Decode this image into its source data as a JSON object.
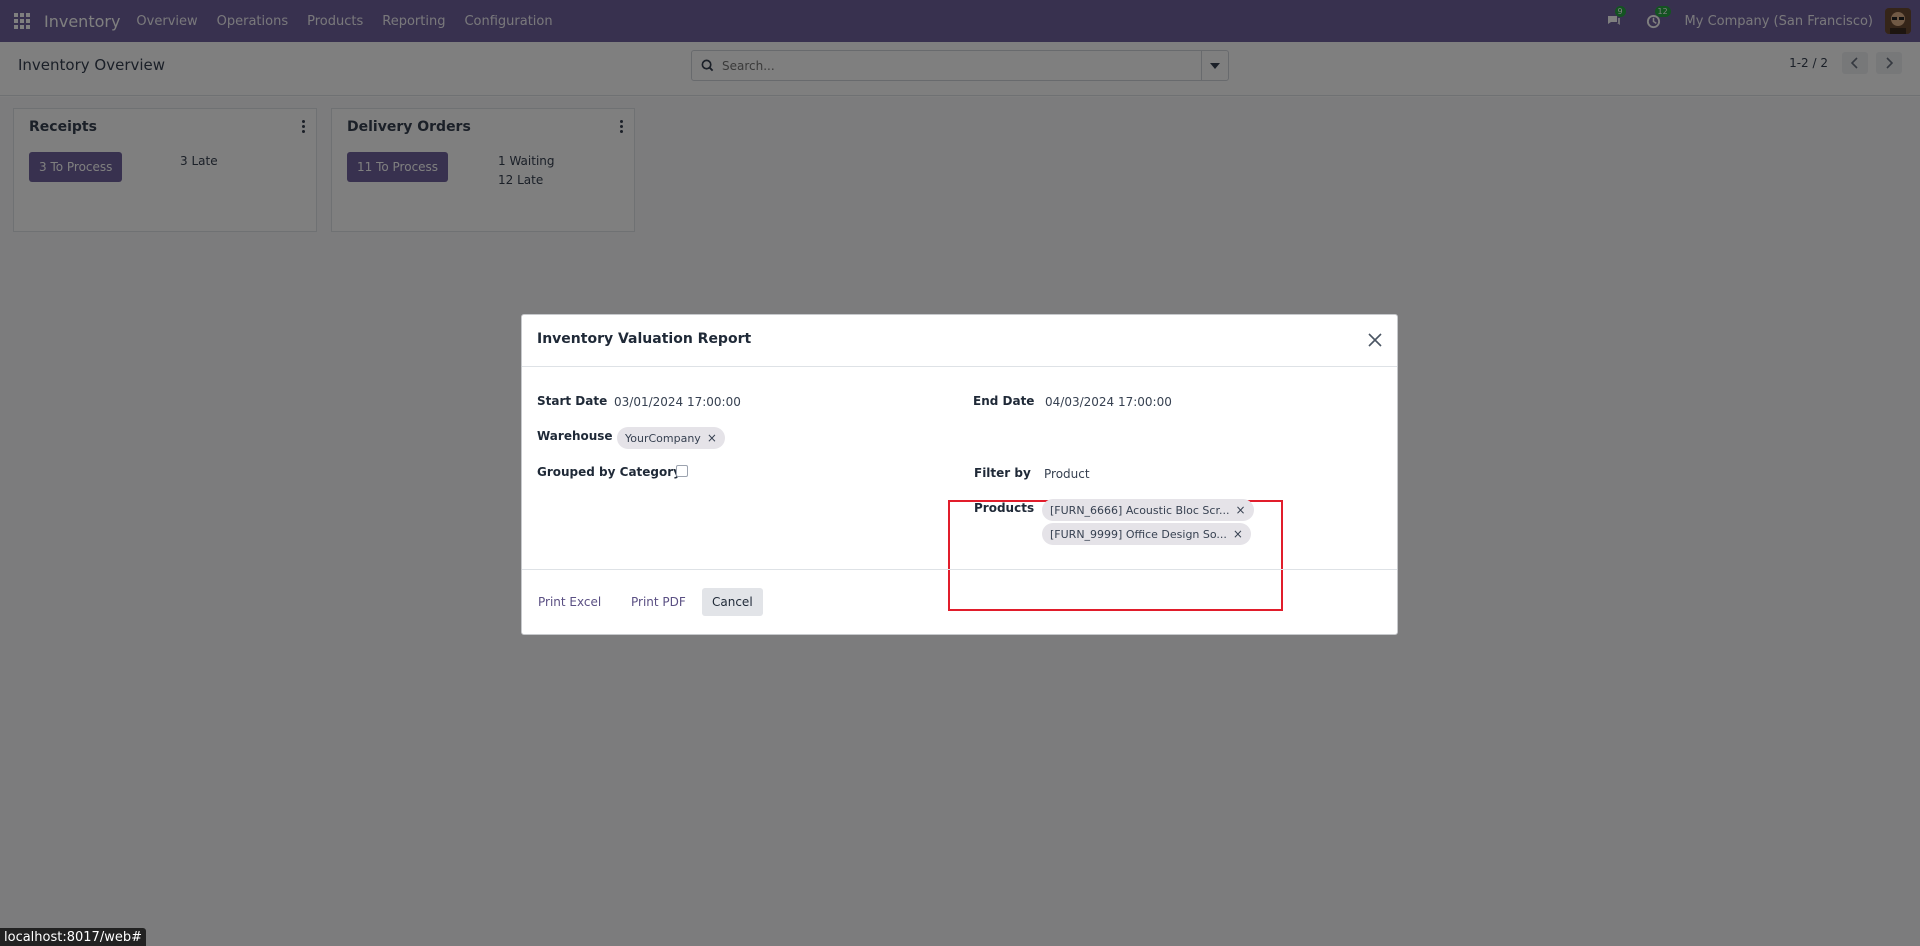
{
  "navbar": {
    "app_name": "Inventory",
    "menu": [
      "Overview",
      "Operations",
      "Products",
      "Reporting",
      "Configuration"
    ],
    "messages_badge": "9",
    "activity_badge": "12",
    "company": "My Company (San Francisco)",
    "accent_color": "#71639e"
  },
  "control_panel": {
    "title": "Inventory Overview",
    "search_placeholder": "Search...",
    "pager": "1-2 / 2"
  },
  "cards": [
    {
      "title": "Receipts",
      "process_label": "3 To Process",
      "stats": [
        "3 Late"
      ]
    },
    {
      "title": "Delivery Orders",
      "process_label": "11 To Process",
      "stats": [
        "1 Waiting",
        "12 Late"
      ]
    }
  ],
  "modal": {
    "title": "Inventory Valuation Report",
    "start_date_label": "Start Date",
    "start_date_value": "03/01/2024 17:00:00",
    "end_date_label": "End Date",
    "end_date_value": "04/03/2024 17:00:00",
    "warehouse_label": "Warehouse",
    "warehouse_tag": "YourCompany",
    "grouped_label": "Grouped by Category",
    "grouped_checked": false,
    "filter_by_label": "Filter by",
    "filter_by_value": "Product",
    "products_label": "Products",
    "products": [
      "[FURN_6666] Acoustic Bloc Scr...",
      "[FURN_9999] Office Design So..."
    ],
    "highlight_color": "#e11d2b",
    "buttons": {
      "print_excel": "Print Excel",
      "print_pdf": "Print PDF",
      "cancel": "Cancel"
    }
  },
  "status_url": "localhost:8017/web#"
}
